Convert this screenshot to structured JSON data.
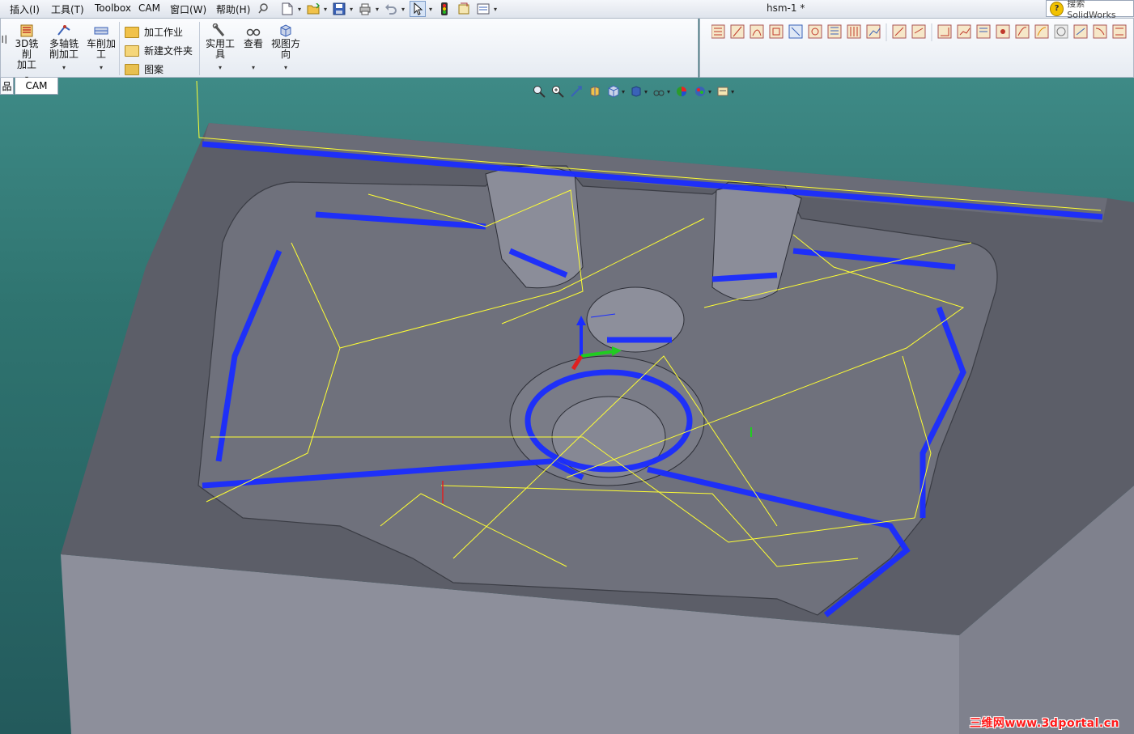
{
  "menubar": {
    "items": [
      "插入(I)",
      "工具(T)",
      "Toolbox",
      "CAM",
      "窗口(W)",
      "帮助(H)"
    ]
  },
  "document": {
    "title": "hsm-1 *"
  },
  "search": {
    "placeholder": "搜索 SolidWorks"
  },
  "ribbon": {
    "mill3d": {
      "label_line1": "3D铣削",
      "label_line2": "加工"
    },
    "multiaxis": {
      "label_line1": "多轴铣",
      "label_line2": "削加工"
    },
    "turning": {
      "label_line1": "车削加",
      "label_line2": "工"
    },
    "setup": "加工作业",
    "new_folder": "新建文件夹",
    "pattern": "图案",
    "utilities": {
      "label_line1": "实用工",
      "label_line2": "具"
    },
    "view": {
      "label_line1": "查看"
    },
    "view_orientation": {
      "label_line1": "视图方",
      "label_line2": "向"
    }
  },
  "tabs": {
    "left_partial": "品",
    "cam": "CAM"
  },
  "watermark": "三维网www.3dportal.cn",
  "colors": {
    "toolpath_blue": "#1a2cff",
    "rapid_yellow": "#ffff33",
    "viewport_top": "#3e8a86",
    "part_gray": "#8d8f9b"
  }
}
